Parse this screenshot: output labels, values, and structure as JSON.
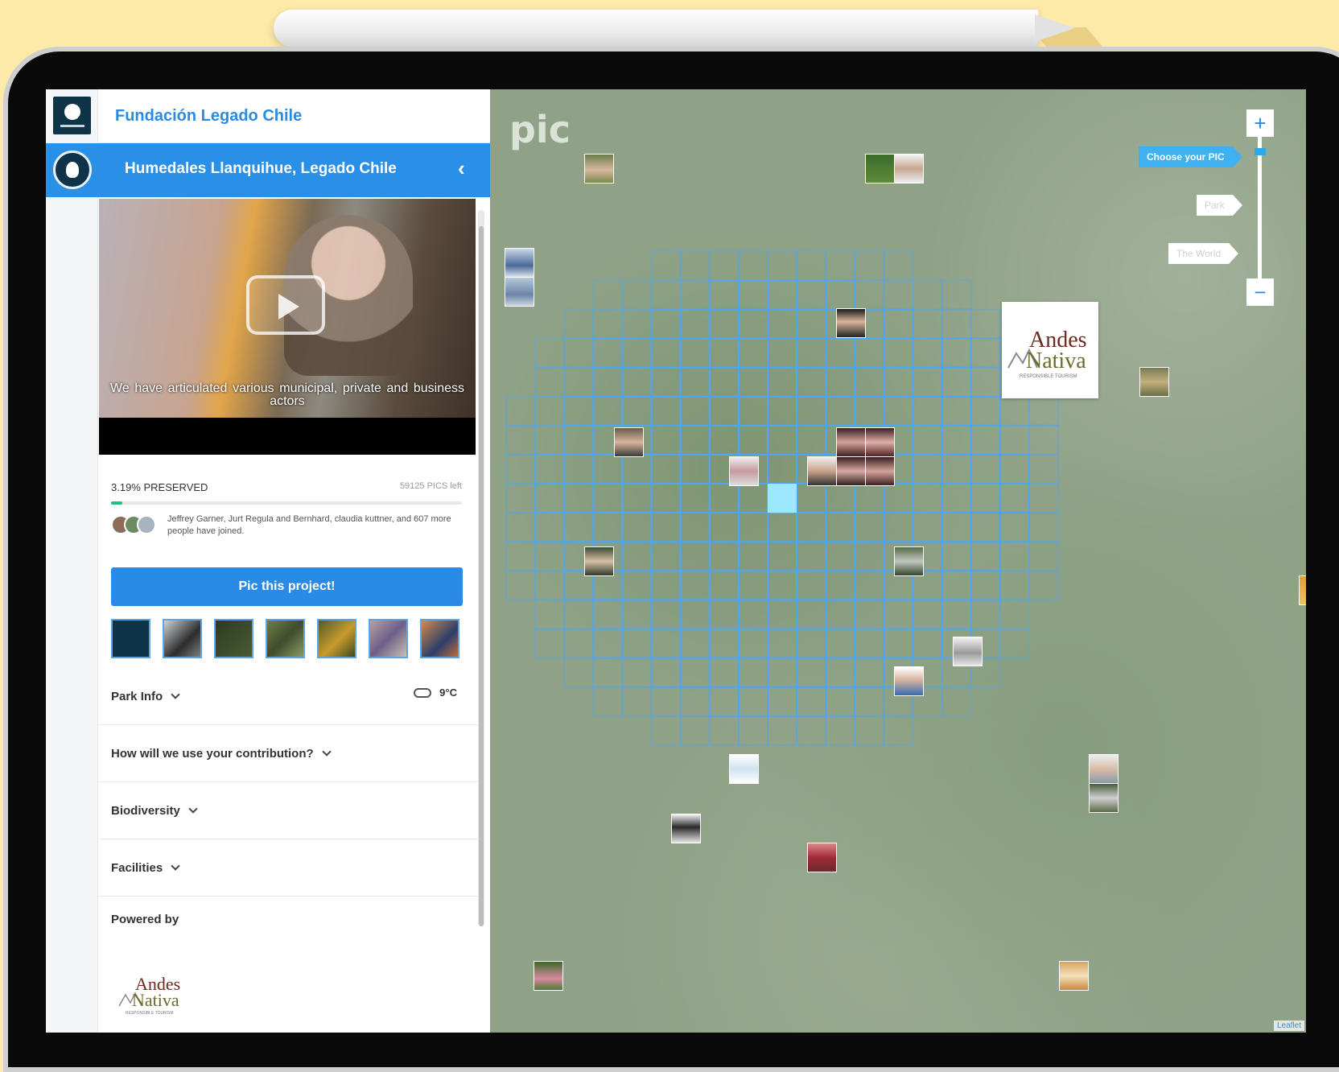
{
  "org": {
    "name": "Fundación Legado Chile"
  },
  "project": {
    "title": "Humedales Llanquihue, Legado Chile",
    "back_glyph": "‹"
  },
  "video": {
    "caption": "We have articulated various municipal, private and business actors"
  },
  "stats": {
    "preserved_label": "3.19% PRESERVED",
    "preserved_fraction": 0.0319,
    "pics_left": "59125 PICS left",
    "joined_text": "Jeffrey Garner, Jurt Regula and Bernhard, claudia kuttner, and 607 more people have joined."
  },
  "cta": {
    "label": "Pic this project!"
  },
  "sections": {
    "park_info": "Park Info",
    "contribution": "How will we use your contribution?",
    "biodiversity": "Biodiversity",
    "facilities": "Facilities",
    "powered_by": "Powered by"
  },
  "weather": {
    "temp": "9°C",
    "icon": "cloud-icon"
  },
  "sponsor": {
    "line1": "Andes",
    "line2": "Nativa",
    "tagline": "RESPONSIBLE TOURISM"
  },
  "map": {
    "logo_text": "pic",
    "zoom_in": "+",
    "zoom_out": "−",
    "levels": {
      "choose": "Choose your PIC",
      "park": "Park",
      "world": "The World"
    },
    "attribution": "Leaflet"
  },
  "colors": {
    "accent": "#2a8be6",
    "progress": "#25c07a",
    "grid": "#4aa6ff",
    "selected_cell": "#9ee8ff"
  }
}
